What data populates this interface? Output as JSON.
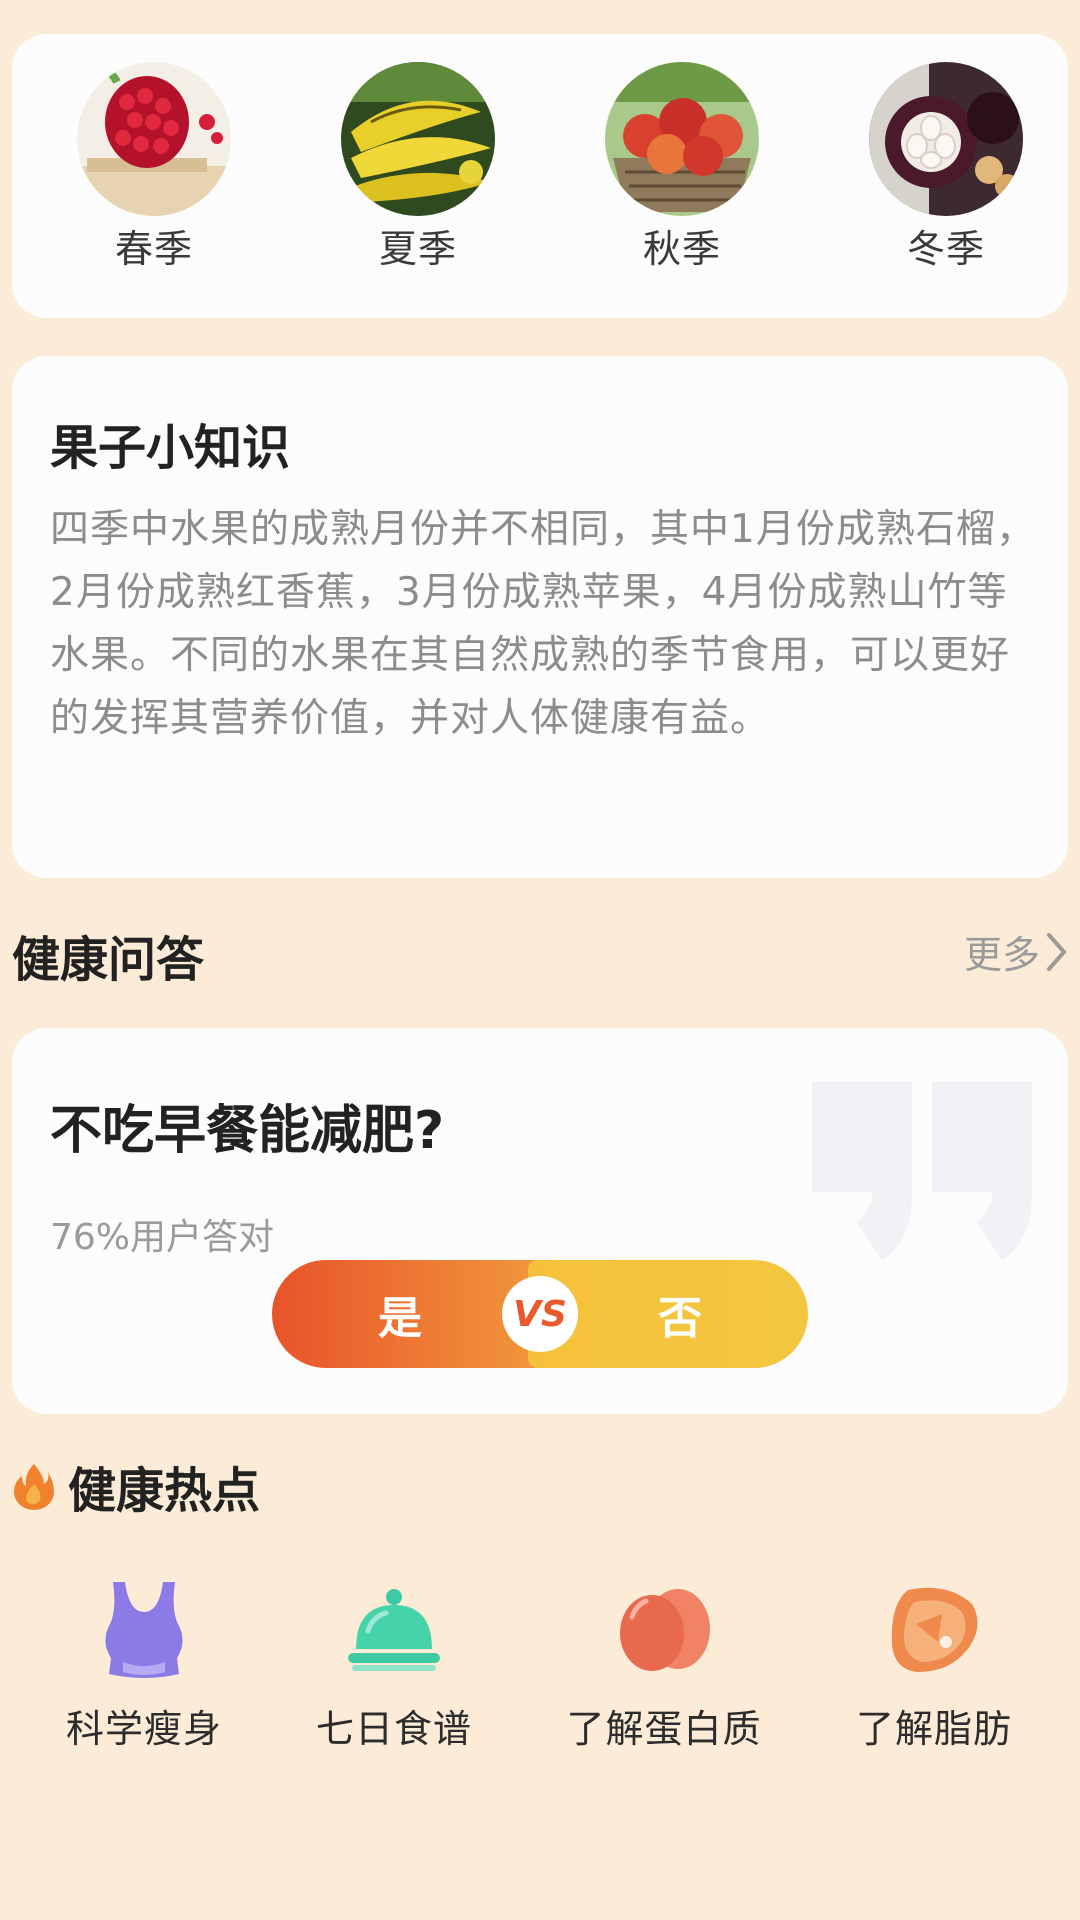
{
  "seasons": [
    {
      "label": "春季",
      "image": "pomegranate"
    },
    {
      "label": "夏季",
      "image": "bananas"
    },
    {
      "label": "秋季",
      "image": "apples-basket"
    },
    {
      "label": "冬季",
      "image": "mangosteen"
    }
  ],
  "knowledge": {
    "title": "果子小知识",
    "body": "四季中水果的成熟月份并不相同，其中1月份成熟石榴，2月份成熟红香蕉，3月份成熟苹果，4月份成熟山竹等水果。不同的水果在其自然成熟的季节食用，可以更好的发挥其营养价值，并对人体健康有益。"
  },
  "qa": {
    "section_title": "健康问答",
    "more_label": "更多",
    "question": "不吃早餐能减肥?",
    "rate_text": "76%用户答对",
    "yes_label": "是",
    "vs_label": "VS",
    "no_label": "否"
  },
  "hot": {
    "section_title": "健康热点",
    "topics": [
      {
        "label": "科学瘦身",
        "icon": "tank-top-icon"
      },
      {
        "label": "七日食谱",
        "icon": "food-cloche-icon"
      },
      {
        "label": "了解蛋白质",
        "icon": "eggs-icon"
      },
      {
        "label": "了解脂肪",
        "icon": "meat-steak-icon"
      }
    ]
  },
  "colors": {
    "background": "#fcecd7",
    "yes_start": "#e8532a",
    "no_color": "#f6c13a"
  }
}
